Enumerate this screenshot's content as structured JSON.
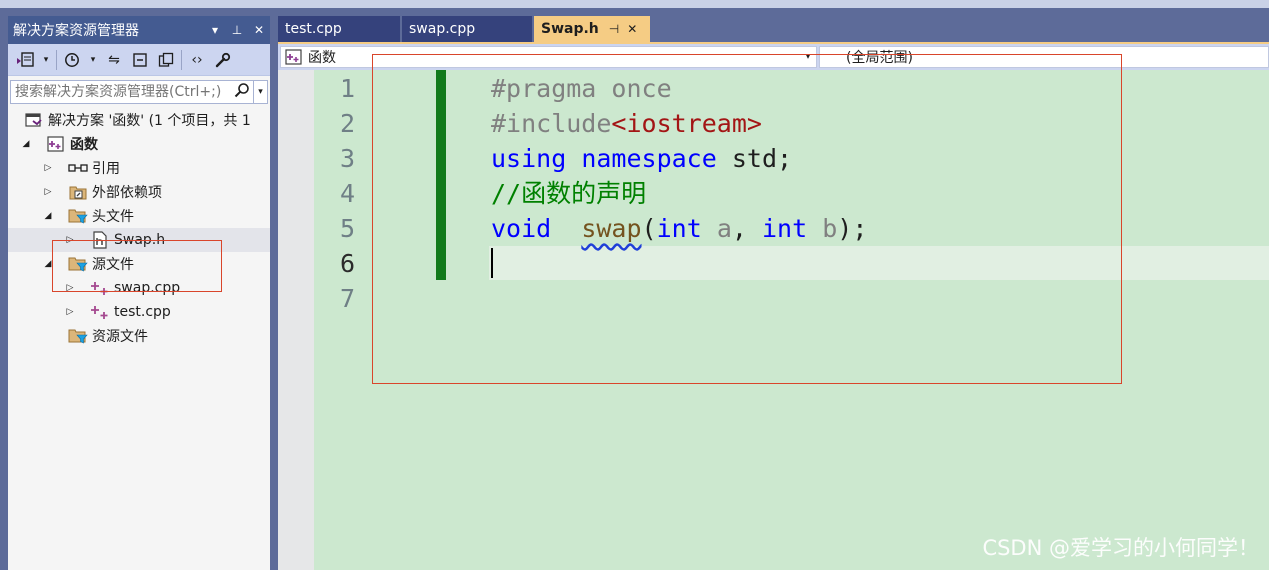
{
  "solution_explorer": {
    "title": "解决方案资源管理器",
    "title_controls": [
      "▾",
      "⊥",
      "✕"
    ],
    "search_placeholder": "搜索解决方案资源管理器(Ctrl+;)",
    "tree": [
      {
        "label": "解决方案 '函数' (1 个项目，共 1",
        "icon": "solution-icon",
        "arrow": ""
      },
      {
        "label": "函数",
        "icon": "project-icon",
        "arrow": "◢"
      },
      {
        "label": "引用",
        "icon": "references-icon",
        "arrow": "▷"
      },
      {
        "label": "外部依赖项",
        "icon": "external-deps-icon",
        "arrow": "▷"
      },
      {
        "label": "头文件",
        "icon": "filter-folder-icon",
        "arrow": "◢"
      },
      {
        "label": "Swap.h",
        "icon": "header-file-icon",
        "arrow": "▷"
      },
      {
        "label": "源文件",
        "icon": "filter-folder-icon",
        "arrow": "◢"
      },
      {
        "label": "swap.cpp",
        "icon": "cpp-file-icon",
        "arrow": "▷"
      },
      {
        "label": "test.cpp",
        "icon": "cpp-file-icon",
        "arrow": "▷"
      },
      {
        "label": "资源文件",
        "icon": "filter-folder-icon",
        "arrow": ""
      }
    ]
  },
  "tabs": [
    {
      "label": "test.cpp",
      "active": false
    },
    {
      "label": "swap.cpp",
      "active": false
    },
    {
      "label": "Swap.h",
      "active": true,
      "pin": "⊣",
      "close": "✕"
    }
  ],
  "navbar": {
    "project": "函数",
    "scope": "(全局范围)"
  },
  "editor": {
    "line_numbers": [
      "1",
      "2",
      "3",
      "4",
      "5",
      "6",
      "7"
    ],
    "code": {
      "l1": "#pragma once",
      "l2_directive": "#include",
      "l2_header": "<iostream>",
      "l3_kw1": "using",
      "l3_kw2": "namespace",
      "l3_rest": " std;",
      "l4_comment": "//函数的声明",
      "l5_kw_void": "void",
      "l5_fn": "swap",
      "l5_paren": "(",
      "l5_kw_int1": "int",
      "l5_param_a": "a",
      "l5_comma": ", ",
      "l5_kw_int2": "int",
      "l5_param_b": "b",
      "l5_end": ");"
    }
  },
  "watermark": "CSDN @爱学习的小何同学！",
  "colors": {
    "editor_bg": "#cce8cf",
    "keyword": "#0000ff",
    "comment": "#008000",
    "string": "#a31515",
    "active_tab": "#f5cc84",
    "annotation_box": "#d9452b"
  }
}
